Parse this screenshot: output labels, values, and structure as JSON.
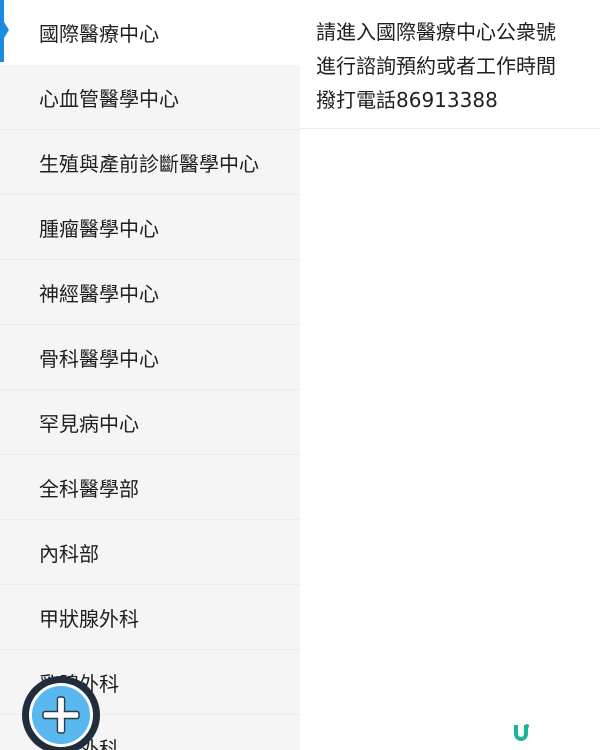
{
  "sidebar": {
    "items": [
      {
        "label": "國際醫療中心"
      },
      {
        "label": "心血管醫學中心"
      },
      {
        "label": "生殖與產前診斷醫學中心"
      },
      {
        "label": "腫瘤醫學中心"
      },
      {
        "label": "神經醫學中心"
      },
      {
        "label": "骨科醫學中心"
      },
      {
        "label": "罕見病中心"
      },
      {
        "label": "全科醫學部"
      },
      {
        "label": "內科部"
      },
      {
        "label": "甲狀腺外科"
      },
      {
        "label": "乳腺外科"
      },
      {
        "label": "泌尿外科"
      }
    ],
    "active_index": 0
  },
  "content": {
    "lines": [
      "請進入國際醫療中心公衆號",
      "進行諮詢預約或者工作時間",
      "撥打電話86913388"
    ]
  },
  "colors": {
    "accent": "#1a8ce0",
    "sidebar_bg": "#f5f5f5",
    "fab_fill": "#5ab7f0",
    "fab_ring": "#1f2d3d",
    "logo": "#1bb59a"
  },
  "icons": {
    "fab": "plus-icon",
    "brand": "u-logo-icon"
  }
}
